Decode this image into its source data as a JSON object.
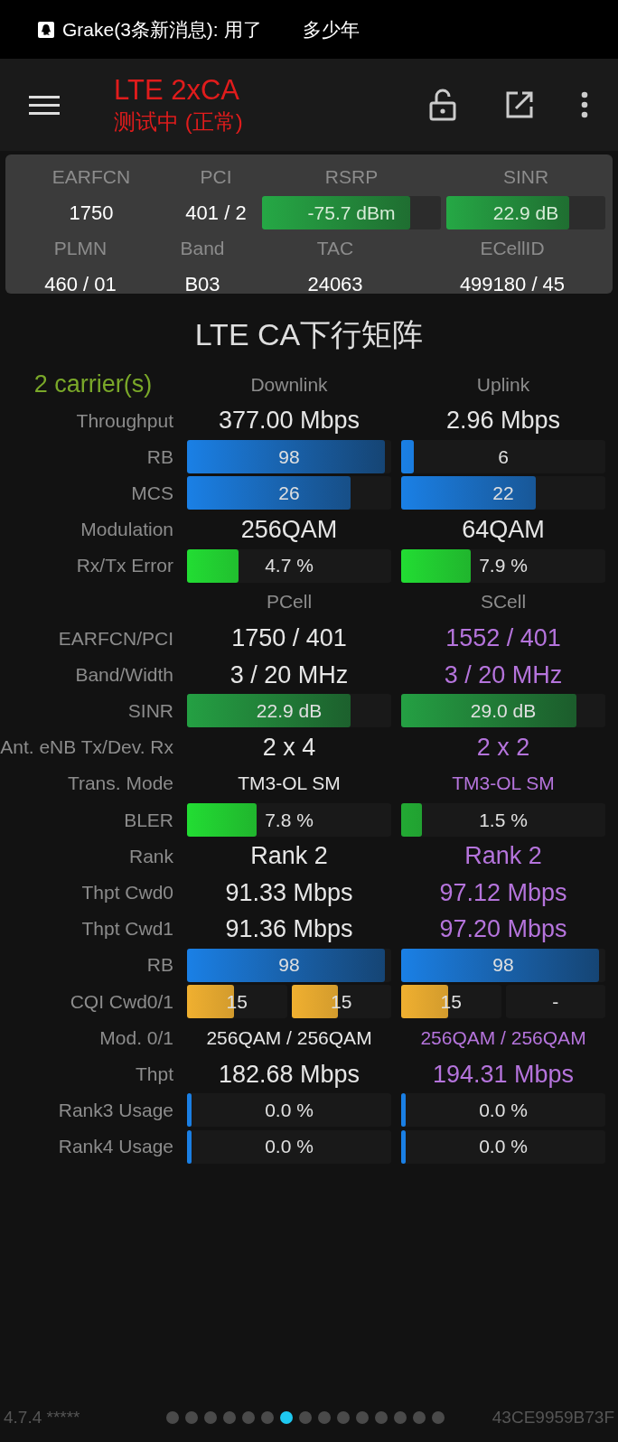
{
  "status_bar": {
    "notification": "Grake(3条新消息): 用了",
    "notification_tail": "多少年"
  },
  "toolbar": {
    "title": "LTE 2xCA",
    "subtitle": "测试中 (正常)"
  },
  "summary": {
    "groups": [
      {
        "cells": [
          {
            "label": "EARFCN",
            "kind": "text",
            "value": "1750"
          },
          {
            "label": "PCI",
            "kind": "text",
            "value": "401 / 2"
          },
          {
            "label": "RSRP",
            "kind": "bar",
            "value": "-75.7 dBm",
            "level": 0.83
          },
          {
            "label": "SINR",
            "kind": "bar",
            "value": "22.9 dB",
            "level": 0.77
          }
        ]
      },
      {
        "cells": [
          {
            "label": "PLMN",
            "kind": "text",
            "value": "460 / 01"
          },
          {
            "label": "Band",
            "kind": "text",
            "value": "B03"
          },
          {
            "label": "TAC",
            "kind": "text",
            "value": "24063"
          },
          {
            "label": "ECellID",
            "kind": "text",
            "value": "499180 / 45"
          }
        ]
      }
    ]
  },
  "matrix": {
    "title": "LTE CA下行矩阵",
    "rows": [
      {
        "kind": "header",
        "label": "2 carrier(s)",
        "cells": [
          {
            "text": "Downlink"
          },
          {
            "text": "Uplink"
          }
        ]
      },
      {
        "kind": "value",
        "label": "Throughput",
        "cells": [
          {
            "text": "377.00 Mbps",
            "color": "#e6e6e6"
          },
          {
            "text": "2.96 Mbps",
            "color": "#e6e6e6"
          }
        ]
      },
      {
        "kind": "bar",
        "label": "RB",
        "cells": [
          {
            "text": "98",
            "level": 0.97,
            "color": "#1a80e6"
          },
          {
            "text": "6",
            "level": 0.06,
            "color": "#1a80e6"
          }
        ]
      },
      {
        "kind": "bar",
        "label": "MCS",
        "cells": [
          {
            "text": "26",
            "level": 0.8,
            "color": "#1a80e6"
          },
          {
            "text": "22",
            "level": 0.66,
            "color": "#1a80e6"
          }
        ]
      },
      {
        "kind": "value",
        "label": "Modulation",
        "cells": [
          {
            "text": "256QAM",
            "color": "#e6e6e6"
          },
          {
            "text": "64QAM",
            "color": "#e6e6e6"
          }
        ]
      },
      {
        "kind": "bar",
        "label": "Rx/Tx Error",
        "cells": [
          {
            "text": "4.7 %",
            "level": 0.25,
            "color": "#22dd33"
          },
          {
            "text": "7.9 %",
            "level": 0.34,
            "color": "#22dd33"
          }
        ]
      },
      {
        "kind": "header",
        "cells": [
          {
            "text": "PCell"
          },
          {
            "text": "SCell"
          }
        ]
      },
      {
        "kind": "value",
        "label": "EARFCN/PCI",
        "cells": [
          {
            "text": "1750 / 401",
            "color": "#e6e6e6"
          },
          {
            "text": "1552 / 401",
            "color": "#b574dc"
          }
        ]
      },
      {
        "kind": "value",
        "label": "Band/Width",
        "cells": [
          {
            "text": "3 / 20 MHz",
            "color": "#e6e6e6"
          },
          {
            "text": "3 / 20 MHz",
            "color": "#b574dc"
          }
        ]
      },
      {
        "kind": "bar",
        "label": "SINR",
        "cells": [
          {
            "text": "22.9 dB",
            "level": 0.8,
            "color": "#24a043"
          },
          {
            "text": "29.0 dB",
            "level": 0.86,
            "color": "#24a043"
          }
        ]
      },
      {
        "kind": "value",
        "label": "Ant. eNB Tx/Dev. Rx",
        "cells": [
          {
            "text": "2 x 4",
            "color": "#e6e6e6"
          },
          {
            "text": "2 x 2",
            "color": "#b574dc"
          }
        ]
      },
      {
        "kind": "compact_value",
        "label": "Trans. Mode",
        "cells": [
          {
            "text": "TM3-OL SM",
            "color": "#e6e6e6"
          },
          {
            "text": "TM3-OL SM",
            "color": "#b574dc"
          }
        ]
      },
      {
        "kind": "bar",
        "label": "BLER",
        "cells": [
          {
            "text": "7.8 %",
            "level": 0.34,
            "color": "#22dd33"
          },
          {
            "text": "1.5 %",
            "level": 0.1,
            "color": "#22aa33"
          }
        ]
      },
      {
        "kind": "value",
        "label": "Rank",
        "cells": [
          {
            "text": "Rank 2",
            "color": "#e6e6e6"
          },
          {
            "text": "Rank 2",
            "color": "#b574dc"
          }
        ]
      },
      {
        "kind": "value",
        "label": "Thpt Cwd0",
        "cells": [
          {
            "text": "91.33 Mbps",
            "color": "#e6e6e6"
          },
          {
            "text": "97.12 Mbps",
            "color": "#b574dc"
          }
        ]
      },
      {
        "kind": "value",
        "label": "Thpt Cwd1",
        "cells": [
          {
            "text": "91.36 Mbps",
            "color": "#e6e6e6"
          },
          {
            "text": "97.20 Mbps",
            "color": "#b574dc"
          }
        ]
      },
      {
        "kind": "bar",
        "label": "RB",
        "cells": [
          {
            "text": "98",
            "level": 0.97,
            "color": "#1a80e6"
          },
          {
            "text": "98",
            "level": 0.97,
            "color": "#1a80e6"
          }
        ]
      },
      {
        "kind": "bar_pair",
        "label": "CQI Cwd0/1",
        "cells": [
          {
            "bars": [
              {
                "text": "15",
                "level": 0.47,
                "color": "#f0b030"
              },
              {
                "text": "15",
                "level": 0.47,
                "color": "#f0b030"
              }
            ]
          },
          {
            "bars": [
              {
                "text": "15",
                "level": 0.47,
                "color": "#f0b030"
              },
              {
                "text": "-"
              }
            ]
          }
        ]
      },
      {
        "kind": "compact_value",
        "label": "Mod. 0/1",
        "cells": [
          {
            "text": "256QAM / 256QAM",
            "color": "#e6e6e6"
          },
          {
            "text": "256QAM / 256QAM",
            "color": "#b574dc"
          }
        ]
      },
      {
        "kind": "value",
        "label": "Thpt",
        "cells": [
          {
            "text": "182.68 Mbps",
            "color": "#e6e6e6"
          },
          {
            "text": "194.31 Mbps",
            "color": "#b574dc"
          }
        ]
      },
      {
        "kind": "bar",
        "label": "Rank3 Usage",
        "cells": [
          {
            "text": "0.0 %",
            "level": 0,
            "color": "#1a80e6"
          },
          {
            "text": "0.0 %",
            "level": 0,
            "color": "#1a80e6"
          }
        ]
      },
      {
        "kind": "bar",
        "label": "Rank4 Usage",
        "cells": [
          {
            "text": "0.0 %",
            "level": 0,
            "color": "#1a80e6"
          },
          {
            "text": "0.0 %",
            "level": 0,
            "color": "#1a80e6"
          }
        ]
      }
    ]
  },
  "footer": {
    "version": "4.7.4 *****",
    "pages": [
      {
        "selected": false
      },
      {
        "selected": false
      },
      {
        "selected": false
      },
      {
        "selected": false
      },
      {
        "selected": false
      },
      {
        "selected": false
      },
      {
        "selected": true
      },
      {
        "selected": false
      },
      {
        "selected": false
      },
      {
        "selected": false
      },
      {
        "selected": false
      },
      {
        "selected": false
      },
      {
        "selected": false
      },
      {
        "selected": false
      },
      {
        "selected": false
      }
    ],
    "device_id": "43CE9959B73F"
  }
}
